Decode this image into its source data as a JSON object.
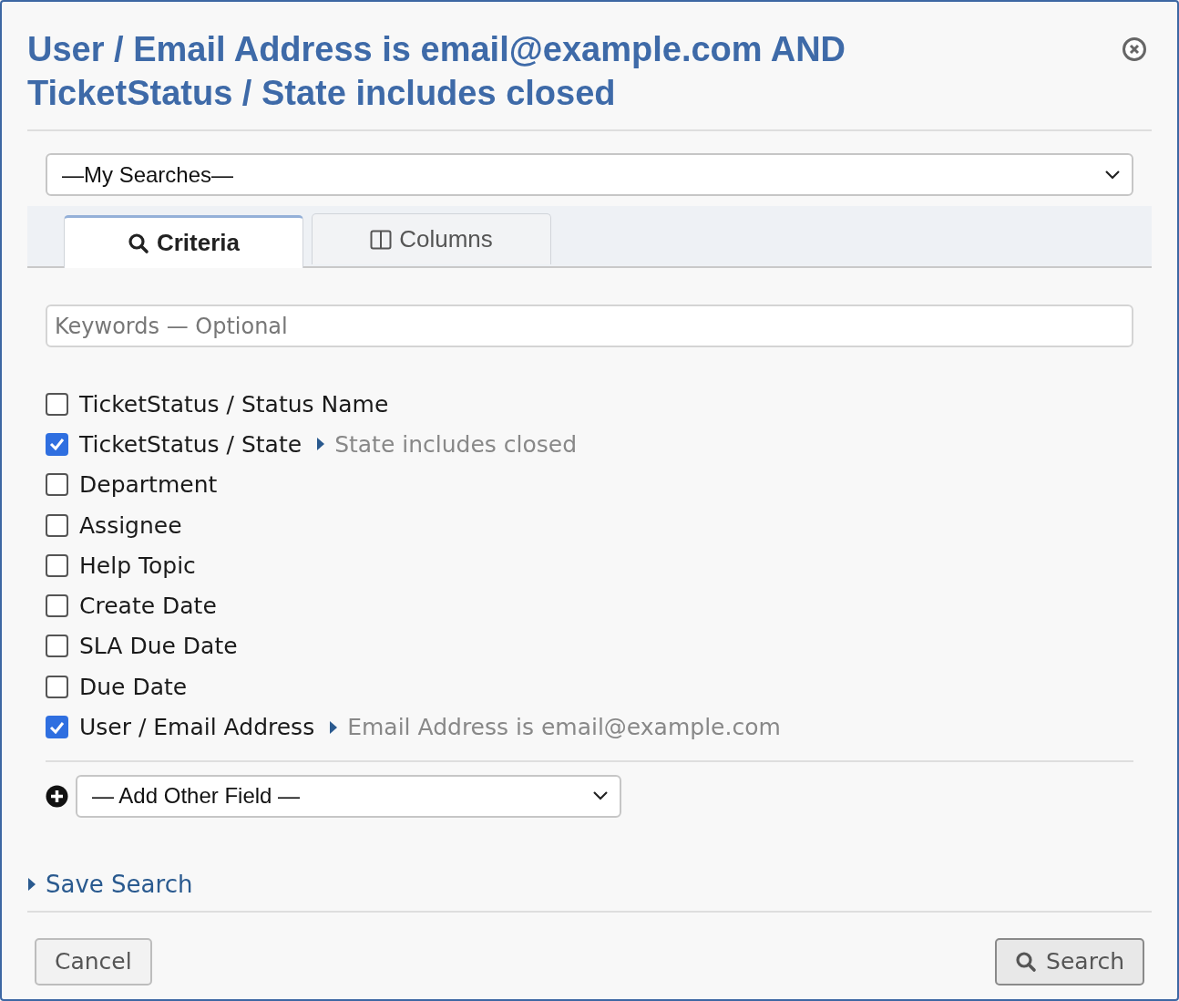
{
  "dialog": {
    "title_lines": [
      "User / Email Address is email@example.com AND",
      "TicketStatus / State includes closed"
    ]
  },
  "my_searches": {
    "value": "—My Searches—"
  },
  "tabs": [
    {
      "label": "Criteria",
      "kind": "search",
      "selected": true
    },
    {
      "label": "Columns",
      "kind": "columns",
      "selected": false
    }
  ],
  "keywords": {
    "placeholder": "Keywords — Optional"
  },
  "criteria": [
    {
      "label": "TicketStatus / Status Name",
      "checked": false
    },
    {
      "label": "TicketStatus / State",
      "checked": true,
      "summary": "State includes closed"
    },
    {
      "label": "Department",
      "checked": false
    },
    {
      "label": "Assignee",
      "checked": false
    },
    {
      "label": "Help Topic",
      "checked": false
    },
    {
      "label": "Create Date",
      "checked": false
    },
    {
      "label": "SLA Due Date",
      "checked": false
    },
    {
      "label": "Due Date",
      "checked": false
    },
    {
      "label": "User / Email Address",
      "checked": true,
      "summary": "Email Address is email@example.com"
    }
  ],
  "add_field": {
    "value": "— Add Other Field —"
  },
  "save_search": {
    "label": "Save Search"
  },
  "buttons": [
    {
      "label": "Cancel",
      "kind": "plain"
    },
    {
      "label": "Search",
      "kind": "search"
    }
  ]
}
